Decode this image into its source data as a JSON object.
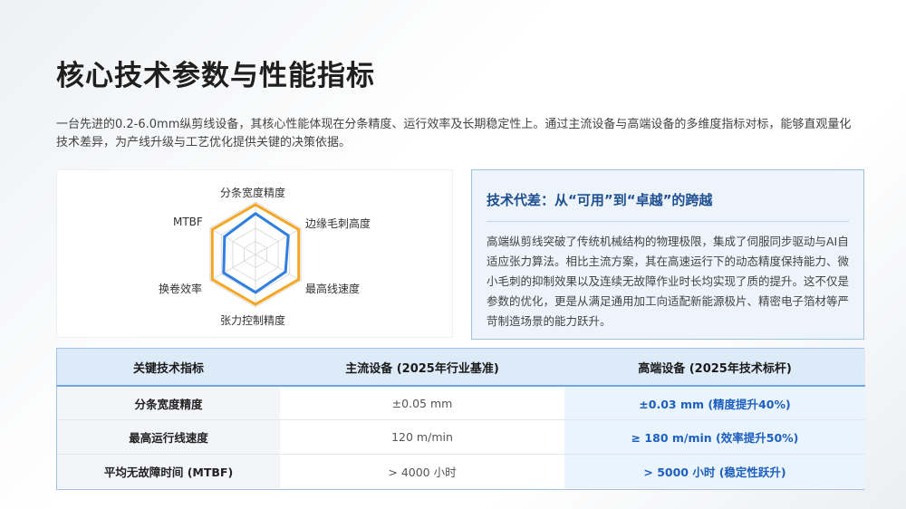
{
  "page": {
    "title": "核心技术参数与性能指标",
    "intro": "一台先进的0.2-6.0mm纵剪线设备，其核心性能体现在分条精度、运行效率及长期稳定性上。通过主流设备与高端设备的多维度指标对标，能够直观量化技术差异，为产线升级与工艺优化提供关键的决策依据。"
  },
  "radar": {
    "axes": [
      "分条宽度精度",
      "边缘毛刺高度",
      "最高线速度",
      "张力控制精度",
      "换卷效率",
      "MTBF"
    ],
    "colors": {
      "high_end": "#f5a623",
      "mainstream": "#2f7fe0",
      "grid": "#dcdcdc"
    },
    "series_values": {
      "high_end": [
        0.95,
        0.95,
        0.95,
        0.95,
        0.95,
        0.95
      ],
      "mainstream": [
        0.78,
        0.72,
        0.66,
        0.72,
        0.7,
        0.68
      ]
    }
  },
  "info": {
    "title": "技术代差：从“可用”到“卓越”的跨越",
    "body": "高端纵剪线突破了传统机械结构的物理极限，集成了伺服同步驱动与AI自适应张力算法。相比主流方案，其在高速运行下的动态精度保持能力、微小毛刺的抑制效果以及连续无故障作业时长均实现了质的提升。这不仅是参数的优化，更是从满足通用加工向适配新能源极片、精密电子箔材等严苛制造场景的能力跃升。"
  },
  "table": {
    "headers": [
      "关键技术指标",
      "主流设备 (2025年行业基准)",
      "高端设备 (2025年技术标杆)"
    ],
    "rows": [
      [
        "分条宽度精度",
        "±0.05 mm",
        "±0.03 mm (精度提升40%)"
      ],
      [
        "最高运行线速度",
        "120 m/min",
        "≥ 180 m/min (效率提升50%)"
      ],
      [
        "平均无故障时间 (MTBF)",
        "> 4000 小时",
        "> 5000 小时 (稳定性跃升)"
      ]
    ]
  }
}
